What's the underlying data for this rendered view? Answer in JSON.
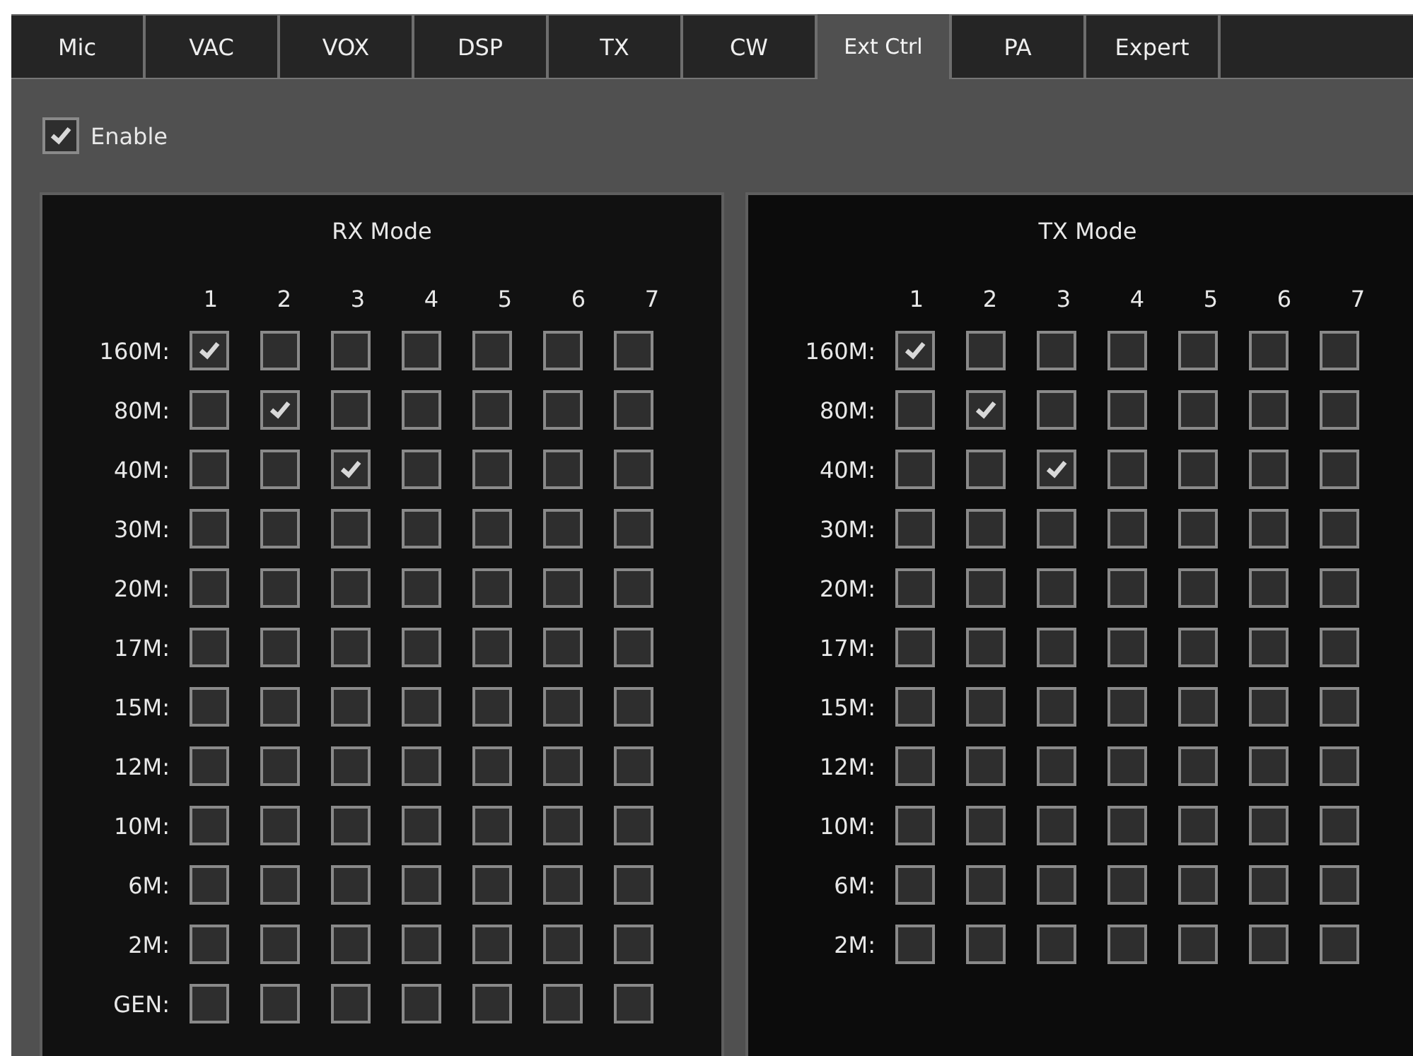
{
  "tabs": [
    {
      "label": "Mic",
      "selected": false
    },
    {
      "label": "VAC",
      "selected": false
    },
    {
      "label": "VOX",
      "selected": false
    },
    {
      "label": "DSP",
      "selected": false
    },
    {
      "label": "TX",
      "selected": false
    },
    {
      "label": "CW",
      "selected": false
    },
    {
      "label": "Ext Ctrl",
      "selected": true
    },
    {
      "label": "PA",
      "selected": false
    },
    {
      "label": "Expert",
      "selected": false
    }
  ],
  "enable": {
    "label": "Enable",
    "checked": true
  },
  "panels": [
    {
      "title": "RX Mode",
      "columns": [
        "1",
        "2",
        "3",
        "4",
        "5",
        "6",
        "7"
      ],
      "rows": [
        {
          "label": "160M:",
          "checks": [
            true,
            false,
            false,
            false,
            false,
            false,
            false
          ]
        },
        {
          "label": "80M:",
          "checks": [
            false,
            true,
            false,
            false,
            false,
            false,
            false
          ]
        },
        {
          "label": "40M:",
          "checks": [
            false,
            false,
            true,
            false,
            false,
            false,
            false
          ]
        },
        {
          "label": "30M:",
          "checks": [
            false,
            false,
            false,
            false,
            false,
            false,
            false
          ]
        },
        {
          "label": "20M:",
          "checks": [
            false,
            false,
            false,
            false,
            false,
            false,
            false
          ]
        },
        {
          "label": "17M:",
          "checks": [
            false,
            false,
            false,
            false,
            false,
            false,
            false
          ]
        },
        {
          "label": "15M:",
          "checks": [
            false,
            false,
            false,
            false,
            false,
            false,
            false
          ]
        },
        {
          "label": "12M:",
          "checks": [
            false,
            false,
            false,
            false,
            false,
            false,
            false
          ]
        },
        {
          "label": "10M:",
          "checks": [
            false,
            false,
            false,
            false,
            false,
            false,
            false
          ]
        },
        {
          "label": "6M:",
          "checks": [
            false,
            false,
            false,
            false,
            false,
            false,
            false
          ]
        },
        {
          "label": "2M:",
          "checks": [
            false,
            false,
            false,
            false,
            false,
            false,
            false
          ]
        },
        {
          "label": "GEN:",
          "checks": [
            false,
            false,
            false,
            false,
            false,
            false,
            false
          ]
        }
      ]
    },
    {
      "title": "TX Mode",
      "columns": [
        "1",
        "2",
        "3",
        "4",
        "5",
        "6",
        "7"
      ],
      "rows": [
        {
          "label": "160M:",
          "checks": [
            true,
            false,
            false,
            false,
            false,
            false,
            false
          ]
        },
        {
          "label": "80M:",
          "checks": [
            false,
            true,
            false,
            false,
            false,
            false,
            false
          ]
        },
        {
          "label": "40M:",
          "checks": [
            false,
            false,
            true,
            false,
            false,
            false,
            false
          ]
        },
        {
          "label": "30M:",
          "checks": [
            false,
            false,
            false,
            false,
            false,
            false,
            false
          ]
        },
        {
          "label": "20M:",
          "checks": [
            false,
            false,
            false,
            false,
            false,
            false,
            false
          ]
        },
        {
          "label": "17M:",
          "checks": [
            false,
            false,
            false,
            false,
            false,
            false,
            false
          ]
        },
        {
          "label": "15M:",
          "checks": [
            false,
            false,
            false,
            false,
            false,
            false,
            false
          ]
        },
        {
          "label": "12M:",
          "checks": [
            false,
            false,
            false,
            false,
            false,
            false,
            false
          ]
        },
        {
          "label": "10M:",
          "checks": [
            false,
            false,
            false,
            false,
            false,
            false,
            false
          ]
        },
        {
          "label": "6M:",
          "checks": [
            false,
            false,
            false,
            false,
            false,
            false,
            false
          ]
        },
        {
          "label": "2M:",
          "checks": [
            false,
            false,
            false,
            false,
            false,
            false,
            false
          ]
        }
      ]
    }
  ]
}
